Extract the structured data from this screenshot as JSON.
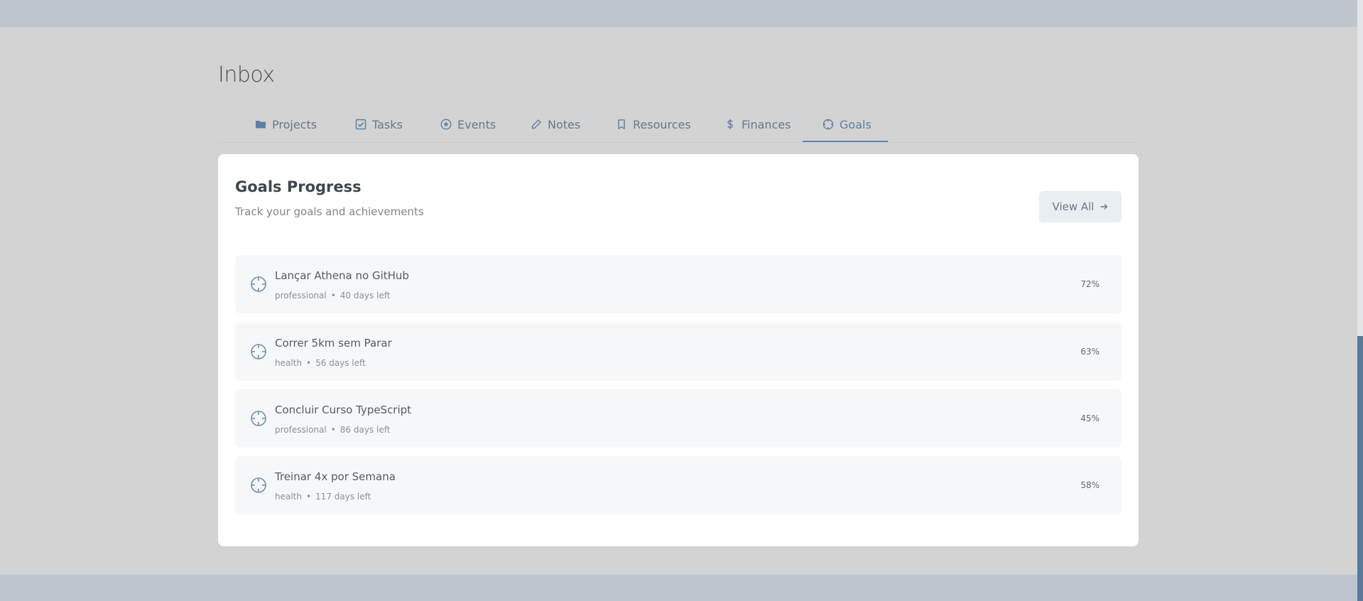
{
  "header": {
    "title": "Inbox"
  },
  "tabs": [
    {
      "label": "Projects",
      "icon": "folder-icon"
    },
    {
      "label": "Tasks",
      "icon": "checkbox-icon"
    },
    {
      "label": "Events",
      "icon": "star-circle-icon"
    },
    {
      "label": "Notes",
      "icon": "pencil-icon"
    },
    {
      "label": "Resources",
      "icon": "bookmark-icon"
    },
    {
      "label": "Finances",
      "icon": "dollar-icon"
    },
    {
      "label": "Goals",
      "icon": "crosshair-icon",
      "active": true
    }
  ],
  "goals_card": {
    "title": "Goals Progress",
    "subtitle": "Track your goals and achievements",
    "view_all_label": "View All",
    "goals": [
      {
        "name": "Lançar Athena no GitHub",
        "category": "professional",
        "days_left": "40 days left",
        "progress": "72%"
      },
      {
        "name": "Correr 5km sem Parar",
        "category": "health",
        "days_left": "56 days left",
        "progress": "63%"
      },
      {
        "name": "Concluir Curso TypeScript",
        "category": "professional",
        "days_left": "86 days left",
        "progress": "45%"
      },
      {
        "name": "Treinar 4x por Semana",
        "category": "health",
        "days_left": "117 days left",
        "progress": "58%"
      }
    ]
  },
  "colors": {
    "accent": "#5d87b5",
    "background": "#d3d3d3",
    "card": "#ffffff"
  }
}
